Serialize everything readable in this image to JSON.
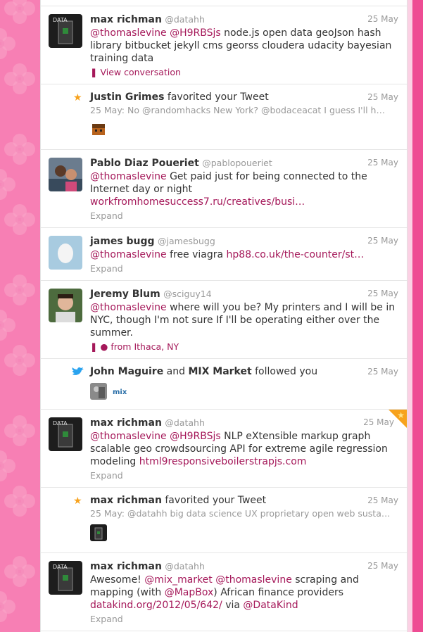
{
  "items": [
    {
      "type": "tweet",
      "name": "max richman",
      "handle": "@datahh",
      "time": "25 May",
      "mentions": [
        "@thomaslevine",
        "@H9RBSjs"
      ],
      "text": "node.js open data geoJson hash library bitbucket jekyll cms georss cloudera udacity bayesian training data",
      "action": "View conversation",
      "avatar_text": "DATA"
    },
    {
      "type": "favorite",
      "actor": "Justin Grimes",
      "verb": "favorited your Tweet",
      "time": "25 May",
      "quote": "25 May: No @randomhacks New York? @bodaceacat I guess I'll h…"
    },
    {
      "type": "tweet",
      "name": "Pablo Diaz Poueriet",
      "handle": "@pablopoueriet",
      "time": "25 May",
      "mention": "@thomaslevine",
      "text": "Get paid just for being connected to the Internet day or night",
      "url": "workfromhomesuccess7.ru/creatives/busi…",
      "expand": "Expand"
    },
    {
      "type": "tweet",
      "name": "james bugg",
      "handle": "@jamesbugg",
      "time": "25 May",
      "mention": "@thomaslevine",
      "text": "free viagra",
      "url": "hp88.co.uk/the-counter/st…",
      "expand": "Expand"
    },
    {
      "type": "tweet",
      "name": "Jeremy Blum",
      "handle": "@sciguy14",
      "time": "25 May",
      "mention": "@thomaslevine",
      "text": "where will you be? My printers and I will be in NYC, though I'm not sure If I'll be operating either over the summer.",
      "location": "from Ithaca, NY"
    },
    {
      "type": "follow",
      "actor1": "John Maguire",
      "and": "and",
      "actor2": "MIX Market",
      "verb": "followed you",
      "time": "25 May",
      "mini_logo": "mix"
    },
    {
      "type": "tweet",
      "name": "max richman",
      "handle": "@datahh",
      "time": "25 May",
      "mentions": [
        "@thomaslevine",
        "@H9RBSjs"
      ],
      "text": "NLP eXtensible markup graph scalable geo crowdsourcing API for extreme agile regression modeling",
      "url": "html9responsiveboilerstrapjs.com",
      "expand": "Expand",
      "avatar_text": "DATA"
    },
    {
      "type": "favorite",
      "actor": "max richman",
      "verb": "favorited your Tweet",
      "time": "25 May",
      "quote": "25 May: @datahh big data science UX proprietary open web susta…"
    },
    {
      "type": "tweet",
      "name": "max richman",
      "handle": "@datahh",
      "time": "25 May",
      "text_a": "Awesome!",
      "m1": "@mix_market",
      "m2": "@thomaslevine",
      "text_b": "scraping and mapping (with",
      "m3": "@MapBox",
      "text_c": ") African finance providers",
      "url": "datakind.org/2012/05/642/",
      "via": "via",
      "m4": "@DataKind",
      "expand": "Expand",
      "avatar_text": "DATA"
    }
  ],
  "colors": {
    "accent": "#a5195a",
    "background": "#f77fb4",
    "star": "#f7a21d"
  }
}
